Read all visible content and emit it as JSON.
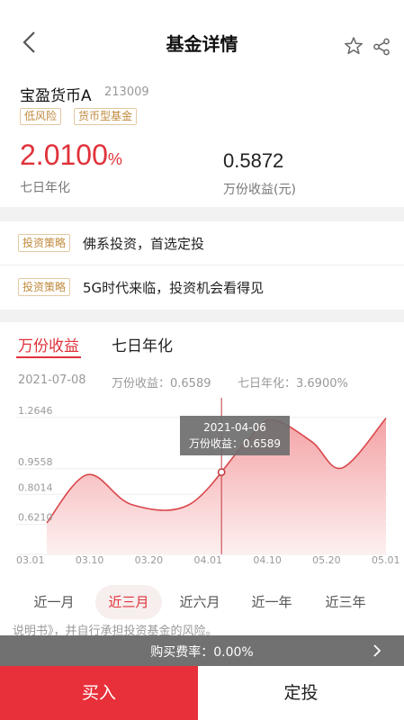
{
  "header": {
    "title": "基金详情"
  },
  "fund": {
    "name": "宝盈货币A",
    "code": "213009",
    "tags": [
      "低风险",
      "货币型基金"
    ],
    "yield_value": "2.0100",
    "yield_unit": "%",
    "yield_label": "七日年化",
    "wan_value": "0.5872",
    "wan_label": "万份收益(元)"
  },
  "strategies": [
    {
      "tag": "投资策略",
      "text": "佛系投资，首选定投"
    },
    {
      "tag": "投资策略",
      "text": "5G时代来临，投资机会看得见"
    }
  ],
  "chart_tabs": [
    {
      "label": "万份收益",
      "active": true
    },
    {
      "label": "七日年化",
      "active": false
    }
  ],
  "info_row": {
    "date": "2021-07-08",
    "wan": "万份收益：0.6589",
    "yield": "七日年化：3.6900%"
  },
  "tooltip": {
    "date": "2021-04-06",
    "value": "万份收益：0.6589"
  },
  "chart_data": {
    "type": "area",
    "x": [
      "03.01",
      "03.10",
      "03.20",
      "04.01",
      "04.10",
      "05.20",
      "05.01"
    ],
    "y_ticks": [
      "1.2646",
      "0.9558",
      "0.8014",
      "0.6210"
    ],
    "ylim": [
      0.44,
      1.35
    ],
    "series": [
      {
        "points": [
          [
            0.0,
            0.63
          ],
          [
            0.12,
            0.92
          ],
          [
            0.25,
            0.74
          ],
          [
            0.42,
            0.74
          ],
          [
            0.58,
            1.1
          ],
          [
            0.66,
            1.25
          ],
          [
            0.78,
            1.12
          ],
          [
            0.87,
            0.96
          ],
          [
            1.0,
            1.26
          ]
        ]
      }
    ],
    "highlight": {
      "x": 0.515,
      "label_date": "2021-04-06",
      "value": 0.6589
    },
    "colors": {
      "line": "#d9464b",
      "fill_top": "#f4a3a6",
      "fill_bottom": "#fdf0f0",
      "crosshair": "#c0393f"
    }
  },
  "periods": [
    {
      "label": "近一月",
      "selected": false
    },
    {
      "label": "近三月",
      "selected": true
    },
    {
      "label": "近六月",
      "selected": false
    },
    {
      "label": "近一年",
      "selected": false
    },
    {
      "label": "近三年",
      "selected": false
    }
  ],
  "disclaimer": "说明书》，并自行承担投资基金的风险。",
  "fee_bar": {
    "text": "购买费率：0.00%"
  },
  "buttons": {
    "buy": "买入",
    "plan": "定投"
  }
}
